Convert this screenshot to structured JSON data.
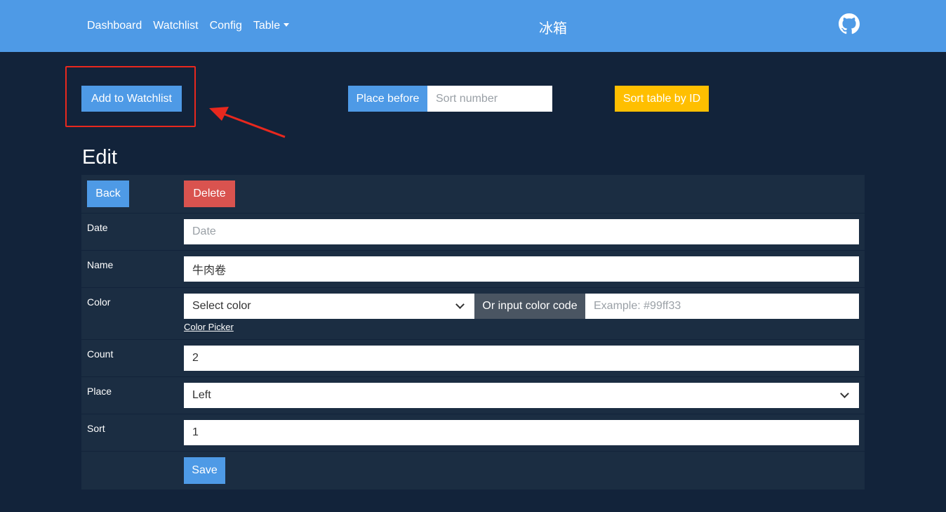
{
  "navbar": {
    "links": [
      "Dashboard",
      "Watchlist",
      "Config",
      "Table"
    ],
    "brand": "冰箱",
    "github_icon": "github-icon"
  },
  "toolbar": {
    "add_label": "Add to Watchlist",
    "place_before_label": "Place before",
    "sort_number_placeholder": "Sort number",
    "sort_table_label": "Sort table by ID"
  },
  "annotation": {
    "color": "#e8281e"
  },
  "edit": {
    "title": "Edit",
    "back_label": "Back",
    "delete_label": "Delete",
    "fields": {
      "date_label": "Date",
      "date_placeholder": "Date",
      "name_label": "Name",
      "name_value": "牛肉卷",
      "color_label": "Color",
      "color_select_value": "Select color",
      "color_code_addon": "Or input color code",
      "color_code_placeholder": "Example: #99ff33",
      "color_picker_link": "Color Picker",
      "count_label": "Count",
      "count_value": "2",
      "place_label": "Place",
      "place_value": "Left",
      "sort_label": "Sort",
      "sort_value": "1"
    },
    "save_label": "Save"
  },
  "colors": {
    "navbar": "#4e9ae6",
    "background": "#12233a",
    "panel": "#1b2d42",
    "primary": "#4e9ae6",
    "danger": "#d9534f",
    "warning": "#ffbf00",
    "addon_gray": "#4a5562"
  }
}
